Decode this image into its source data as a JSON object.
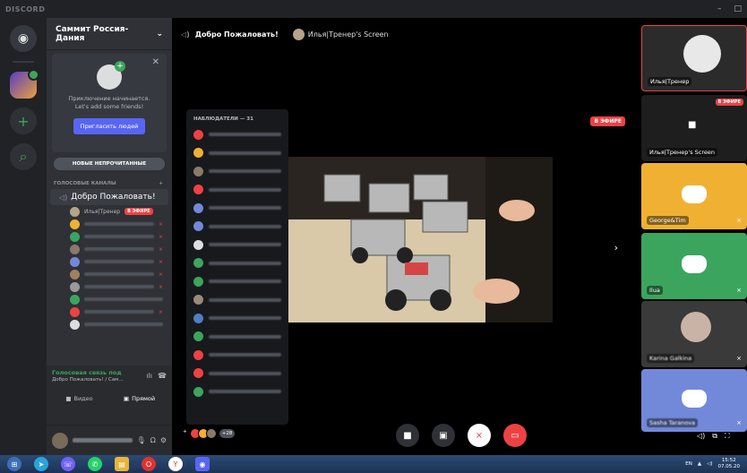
{
  "titlebar": {
    "brand": "DISCORD",
    "minimize": "–",
    "maximize": "□"
  },
  "server": {
    "name": "Саммит Россия-Дания"
  },
  "invite": {
    "line1": "Приключение начинается.",
    "line2": "Let's add some friends!",
    "button": "Пригласить людей"
  },
  "new_unread": "НОВЫЕ НЕПРОЧИТАННЫЕ",
  "voice_category": "ГОЛОСОВЫЕ КАНАЛЫ",
  "voice_channel": "Добро Пожаловать!",
  "streamer": {
    "name": "Илья|Тренер",
    "badge": "В ЭФИРЕ"
  },
  "voice_panel": {
    "status": "Голосовая связь под",
    "channel": "Добро Пожаловать! / Сам...",
    "video": "Видео",
    "screen": "Прямой"
  },
  "main": {
    "channel": "Добро Пожаловать!",
    "stream_title": "Илья|Тренер's Screen",
    "live_badge": "В ЭФИРЕ",
    "viewers_header": "НАБЛЮДАТЕЛИ — 31",
    "viewer_count": "+28"
  },
  "tiles": [
    {
      "label": "Илья|Тренер",
      "color": "#2b2b2b"
    },
    {
      "label": "Илья|Тренер's Screen",
      "color": "#1e1e1e",
      "badge": "В ЭФИРЕ"
    },
    {
      "label": "George&Tim",
      "color": "#f0b132"
    },
    {
      "label": "Ilua",
      "color": "#3ba55d"
    },
    {
      "label": "Karina Galkina",
      "color": "#3a3a3a"
    },
    {
      "label": "Sasha Taranova",
      "color": "#7289da"
    }
  ],
  "taskbar": {
    "lang": "EN",
    "time": "15:52",
    "date": "07.05.20"
  },
  "colors": {
    "accent": "#5865f2",
    "live": "#ed4245",
    "online": "#3ba55d"
  }
}
